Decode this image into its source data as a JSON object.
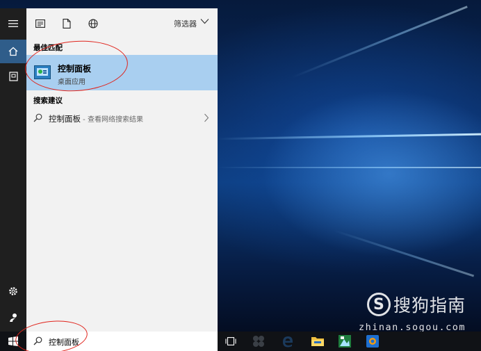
{
  "left_rail": {
    "items": [
      {
        "name": "hamburger-icon"
      },
      {
        "name": "home-icon",
        "active": true
      },
      {
        "name": "document-icon"
      },
      {
        "name": "settings-icon"
      },
      {
        "name": "user-icon"
      }
    ]
  },
  "filter_bar": {
    "filters": [
      "apps-icon",
      "documents-icon",
      "web-icon"
    ],
    "label": "筛选器"
  },
  "best_match": {
    "section_title": "最佳匹配",
    "name": "控制面板",
    "subtitle": "桌面应用",
    "icon": "control-panel-icon"
  },
  "suggestions": {
    "section_title": "搜索建议",
    "items": [
      {
        "term": "控制面板",
        "separator": " - ",
        "hint": "查看网络搜索结果"
      }
    ]
  },
  "taskbar": {
    "search_value": "控制面板",
    "apps": [
      "task-view-icon",
      "app-grid-icon",
      "edge-icon",
      "file-explorer-icon",
      "photos-icon",
      "outlook-icon"
    ]
  },
  "watermark": {
    "logo_letter": "S",
    "brand": "搜狗指南",
    "url": "zhinan.sogou.com"
  },
  "colors": {
    "panel_bg": "#f2f2f2",
    "highlight": "#a9cff0",
    "rail_bg": "#1f1f1f",
    "rail_active": "#2f5d8a",
    "taskbar_bg": "#101216",
    "annotation": "#e0231b"
  }
}
